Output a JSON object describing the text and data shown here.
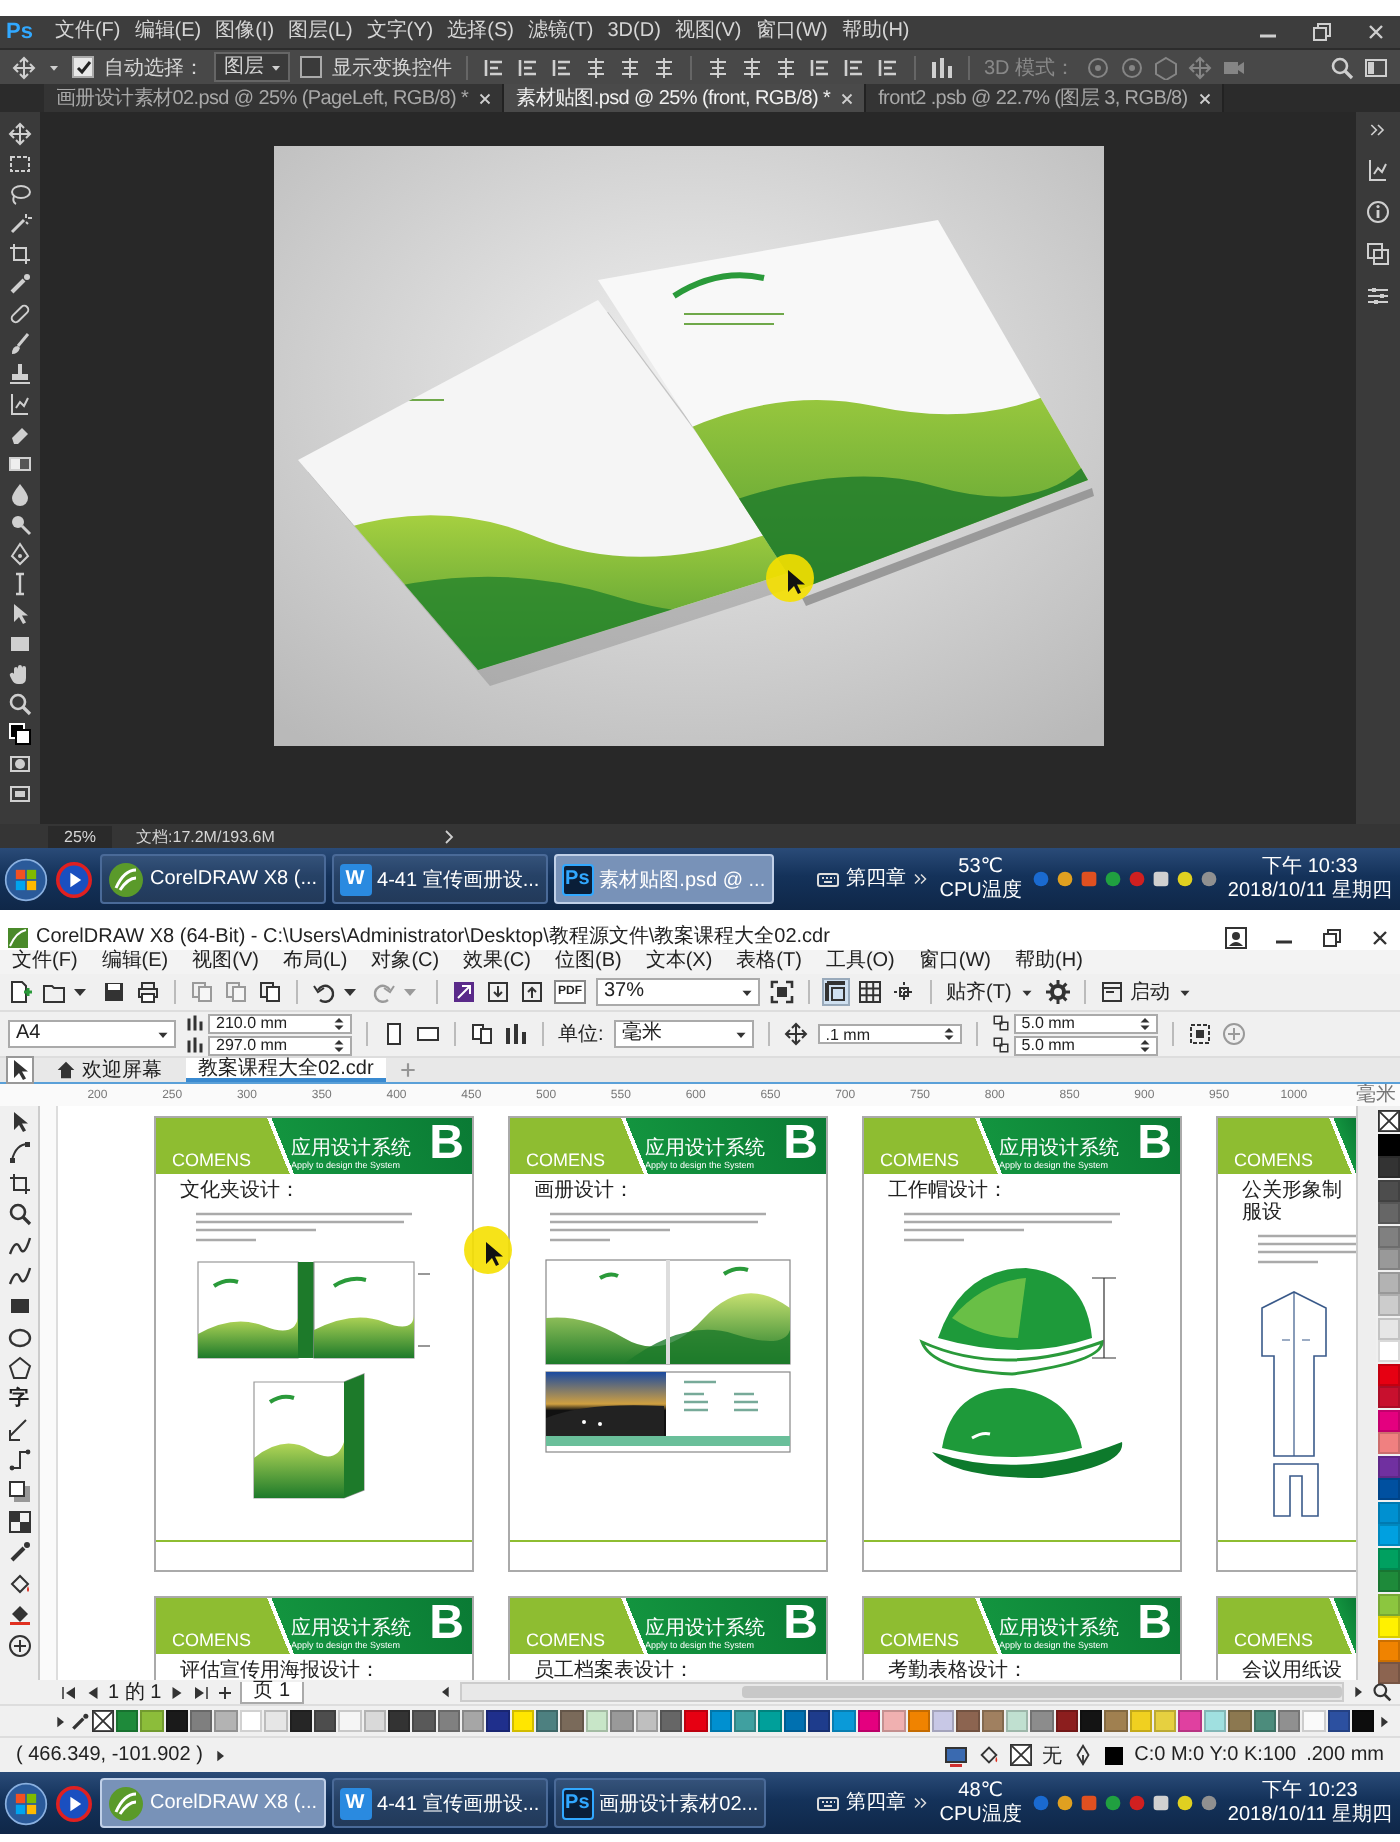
{
  "photoshop": {
    "app_badge": "Ps",
    "menu": [
      "文件(F)",
      "编辑(E)",
      "图像(I)",
      "图层(L)",
      "文字(Y)",
      "选择(S)",
      "滤镜(T)",
      "3D(D)",
      "视图(V)",
      "窗口(W)",
      "帮助(H)"
    ],
    "options": {
      "auto_select": {
        "label": "自动选择：",
        "checked": true
      },
      "target": "图层",
      "show_transform": {
        "label": "显示变换控件",
        "checked": false
      },
      "mode_3d": "3D 模式："
    },
    "tabs": [
      {
        "label": "画册设计素材02.psd @ 25% (PageLeft, RGB/8) *",
        "selected": false
      },
      {
        "label": "素材贴图.psd @ 25% (front, RGB/8) *",
        "selected": true
      },
      {
        "label": "front2 .psb @ 22.7% (图层 3, RGB/8)",
        "selected": false
      }
    ],
    "status": {
      "zoom": "25%",
      "document": "文档:17.2M/193.6M"
    }
  },
  "taskbar_top": {
    "tasks": [
      {
        "kind": "corel",
        "label": "CorelDRAW X8 (...",
        "selected": false
      },
      {
        "kind": "wps",
        "icon_text": "W",
        "label": "4-41 宣传画册设...",
        "selected": false
      },
      {
        "kind": "ps",
        "icon_text": "Ps",
        "label": "素材贴图.psd @ ...",
        "selected": true
      }
    ],
    "input_label": "第四章",
    "temperature": "53℃",
    "temperature_label": "CPU温度",
    "time": "下午 10:33",
    "date": "2018/10/11 星期四"
  },
  "coreldraw": {
    "title": "CorelDRAW X8 (64-Bit) - C:\\Users\\Administrator\\Desktop\\教程源文件\\教案课程大全02.cdr",
    "menu": [
      "文件(F)",
      "编辑(E)",
      "视图(V)",
      "布局(L)",
      "对象(C)",
      "效果(C)",
      "位图(B)",
      "文本(X)",
      "表格(T)",
      "工具(O)",
      "窗口(W)",
      "帮助(H)"
    ],
    "toolbar": {
      "pdf": "PDF",
      "zoom": "37%",
      "snap": "贴齐(T)",
      "launch": "启动"
    },
    "properties": {
      "page_size": "A4",
      "width": "210.0 mm",
      "height": "297.0 mm",
      "unit_label": "单位:",
      "unit": "毫米",
      "nudge": ".1 mm",
      "duplicate_x": "5.0 mm",
      "duplicate_y": "5.0 mm"
    },
    "tabs": [
      {
        "kind": "home",
        "label": "欢迎屏幕",
        "selected": false
      },
      {
        "kind": "document",
        "label": "教案课程大全02.cdr",
        "selected": true
      }
    ],
    "ruler": [
      "200",
      "250",
      "300",
      "350",
      "400",
      "450",
      "500",
      "550",
      "600",
      "650",
      "700",
      "750",
      "800",
      "850",
      "900",
      "950",
      "1000"
    ],
    "ruler_unit": "毫米",
    "text_tool": "字",
    "page_rows": [
      [
        {
          "brand": "COMENS",
          "system": "应用设计系统",
          "subtitle": "Apply to design the System",
          "letter": "B",
          "heading": "文化夹设计：",
          "kind": "binder"
        },
        {
          "brand": "COMENS",
          "system": "应用设计系统",
          "subtitle": "Apply to design the System",
          "letter": "B",
          "heading": "画册设计：",
          "kind": "brochure"
        },
        {
          "brand": "COMENS",
          "system": "应用设计系统",
          "subtitle": "Apply to design the System",
          "letter": "B",
          "heading": "工作帽设计：",
          "kind": "cap"
        },
        {
          "brand": "COMENS",
          "heading": "公关形象制服设",
          "kind": "uniform"
        }
      ],
      [
        {
          "brand": "COMENS",
          "system": "应用设计系统",
          "subtitle": "Apply to design the System",
          "letter": "B",
          "heading": "评估宣传用海报设计："
        },
        {
          "brand": "COMENS",
          "system": "应用设计系统",
          "subtitle": "Apply to design the System",
          "letter": "B",
          "heading": "员工档案表设计："
        },
        {
          "brand": "COMENS",
          "system": "应用设计系统",
          "subtitle": "Apply to design the System",
          "letter": "B",
          "heading": "考勤表格设计："
        },
        {
          "brand": "COMENS",
          "heading": "会议用纸设"
        }
      ]
    ],
    "page_nav": {
      "position": "1 的 1",
      "page_tab": "页 1"
    },
    "palette": [
      {
        "color": "#1e8a3a"
      },
      {
        "color": "#8cbd3a"
      },
      {
        "color": "#1a1a1a"
      },
      {
        "color": "#7f7f7f"
      },
      {
        "color": "#b3b3b3"
      },
      {
        "color": "#ffffff"
      },
      {
        "color": "#e6e6e6"
      },
      {
        "color": "#262626"
      },
      {
        "color": "#4d4d4d"
      },
      {
        "color": "#f5f5f5"
      },
      {
        "color": "#d9d9d9"
      },
      {
        "color": "#333333"
      },
      {
        "color": "#595959"
      },
      {
        "color": "#808080"
      },
      {
        "color": "#a6a6a6"
      },
      {
        "color": "#1f2f8c"
      },
      {
        "color": "#ffe600"
      },
      {
        "color": "#4d8080"
      },
      {
        "color": "#7a6a5a"
      },
      {
        "color": "#c8e6c8"
      },
      {
        "color": "#999999"
      },
      {
        "color": "#bfbfbf"
      },
      {
        "color": "#666666"
      },
      {
        "color": "#e60012"
      },
      {
        "color": "#0090d0"
      },
      {
        "color": "#40a0a0"
      },
      {
        "color": "#00a09a"
      },
      {
        "color": "#0070b0"
      },
      {
        "color": "#1e3c8c"
      },
      {
        "color": "#0a9ad8"
      },
      {
        "color": "#e4007f"
      },
      {
        "color": "#f0b0b0"
      },
      {
        "color": "#f08300"
      },
      {
        "color": "#c8c8e6"
      },
      {
        "color": "#8c6450"
      },
      {
        "color": "#a08060"
      },
      {
        "color": "#c0e0d0"
      },
      {
        "color": "#8c8c8c"
      },
      {
        "color": "#8c1e1e"
      },
      {
        "color": "#141414"
      },
      {
        "color": "#a08050"
      },
      {
        "color": "#f0d020"
      },
      {
        "color": "#e6d040"
      },
      {
        "color": "#e040a0"
      },
      {
        "color": "#a0e0e0"
      },
      {
        "color": "#8c7850"
      },
      {
        "color": "#4c8c7c"
      },
      {
        "color": "#909090"
      },
      {
        "color": "#fafafa"
      },
      {
        "color": "#2c50a0"
      },
      {
        "color": "#0d0d0d"
      }
    ],
    "side_palette": [
      {
        "color": "#000000"
      },
      {
        "color": "#333333"
      },
      {
        "color": "#4d4d4d"
      },
      {
        "color": "#666666"
      },
      {
        "color": "#808080"
      },
      {
        "color": "#999999"
      },
      {
        "color": "#b3b3b3"
      },
      {
        "color": "#cccccc"
      },
      {
        "color": "#e6e6e6"
      },
      {
        "color": "#ffffff"
      },
      {
        "color": "#e60012"
      },
      {
        "color": "#c8102e"
      },
      {
        "color": "#e4007f"
      },
      {
        "color": "#f08080"
      },
      {
        "color": "#7030a0"
      },
      {
        "color": "#0050a0"
      },
      {
        "color": "#0090d0"
      },
      {
        "color": "#00a0e0"
      },
      {
        "color": "#00a060"
      },
      {
        "color": "#1e8a3a"
      },
      {
        "color": "#8cc63f"
      },
      {
        "color": "#fff100"
      },
      {
        "color": "#f08300"
      },
      {
        "color": "#8c6450"
      }
    ],
    "status": {
      "coordinates": "( 466.349, -101.902 )",
      "fill": "无",
      "outline": "C:0 M:0 Y:0 K:100",
      "outline_width": ".200 mm"
    }
  },
  "taskbar_bottom": {
    "tasks": [
      {
        "kind": "corel",
        "label": "CorelDRAW X8 (...",
        "selected": true
      },
      {
        "kind": "wps",
        "icon_text": "W",
        "label": "4-41 宣传画册设...",
        "selected": false
      },
      {
        "kind": "ps",
        "icon_text": "Ps",
        "label": "画册设计素材02...",
        "selected": false
      }
    ],
    "input_label": "第四章",
    "temperature": "48℃",
    "temperature_label": "CPU温度",
    "time": "下午 10:23",
    "date": "2018/10/11 星期四"
  }
}
